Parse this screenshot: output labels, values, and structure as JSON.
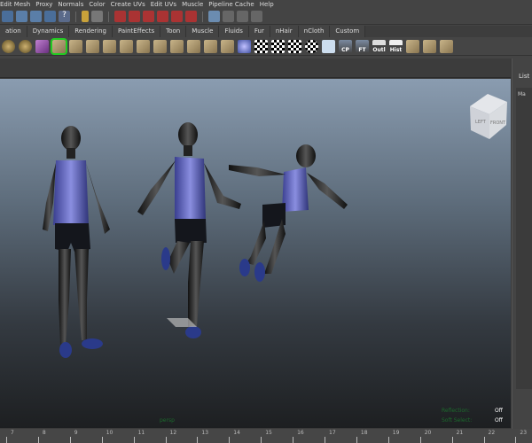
{
  "menu": [
    "Edit Mesh",
    "Proxy",
    "Normals",
    "Color",
    "Create UVs",
    "Edit UVs",
    "Muscle",
    "Pipeline Cache",
    "Help"
  ],
  "tabs": [
    "ation",
    "Dynamics",
    "Rendering",
    "PaintEffects",
    "Toon",
    "Muscle",
    "Fluids",
    "Fur",
    "nHair",
    "nCloth",
    "Custom"
  ],
  "shelf_labels": {
    "cp": "CP",
    "ft": "FT",
    "outl": "Outl",
    "hist": "Hist"
  },
  "viewcube": {
    "left": "LEFT",
    "front": "FRONT"
  },
  "right_panel": {
    "list": "List",
    "ma": "Ma"
  },
  "hud": {
    "camera": "persp",
    "reflection_label": "Reflection:",
    "reflection_value": "Off",
    "soft_select_label": "Soft Select:",
    "soft_select_value": "Off"
  },
  "timeline": {
    "ticks": [
      "7",
      "8",
      "9",
      "10",
      "11",
      "12",
      "13",
      "14",
      "15",
      "16",
      "17",
      "18",
      "19",
      "20",
      "21",
      "22",
      "23"
    ]
  }
}
